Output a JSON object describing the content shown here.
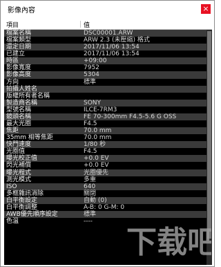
{
  "window": {
    "title": "影像內容",
    "close_glyph": "×"
  },
  "columns": {
    "item": "項目",
    "value": "值"
  },
  "rows": [
    {
      "key": "檔案名稱",
      "value": "DSC00001.ARW"
    },
    {
      "key": "檔案類型",
      "value": "ARW 2.3 (未壓縮) 格式"
    },
    {
      "key": "還定日期",
      "value": "2017/11/06 13:54"
    },
    {
      "key": "已建立",
      "value": "2017/11/06 13:54"
    },
    {
      "key": "時區",
      "value": "+09:00"
    },
    {
      "key": "影像寬度",
      "value": "7952"
    },
    {
      "key": "影像高度",
      "value": "5304"
    },
    {
      "key": "方向",
      "value": "標準"
    },
    {
      "key": "拍攝人姓名",
      "value": ""
    },
    {
      "key": "版權所有者名稱",
      "value": ""
    },
    {
      "key": "製造商名稱",
      "value": "SONY"
    },
    {
      "key": "型號名稱",
      "value": "ILCE-7RM3"
    },
    {
      "key": "鏡頭名稱",
      "value": "FE 70-300mm F4.5-5.6 G OSS"
    },
    {
      "key": "最大光圈",
      "value": "F4.5"
    },
    {
      "key": "焦距",
      "value": "70.0 mm"
    },
    {
      "key": "35mm 相等焦距",
      "value": "70.0 mm"
    },
    {
      "key": "快門速度",
      "value": "1/80 秒"
    },
    {
      "key": "光圈值",
      "value": "F4.5"
    },
    {
      "key": "曝光校正值",
      "value": "+0.0 EV"
    },
    {
      "key": "閃光補償",
      "value": "+0.0 EV"
    },
    {
      "key": "曝光程式",
      "value": "光圈優先"
    },
    {
      "key": "測光模式",
      "value": "多重"
    },
    {
      "key": "ISO",
      "value": "640"
    },
    {
      "key": "多框雜訊消除",
      "value": "關閉"
    },
    {
      "key": "白平衡設定",
      "value": "自動 (0)"
    },
    {
      "key": "白平衡調整",
      "value": "A-B: 0 G-M: 0"
    },
    {
      "key": "AWB優先順序設定",
      "value": "標準"
    },
    {
      "key": "色溫",
      "value": "----"
    }
  ],
  "watermark": {
    "text": "下载吧",
    "color": "#9a9a9a"
  }
}
